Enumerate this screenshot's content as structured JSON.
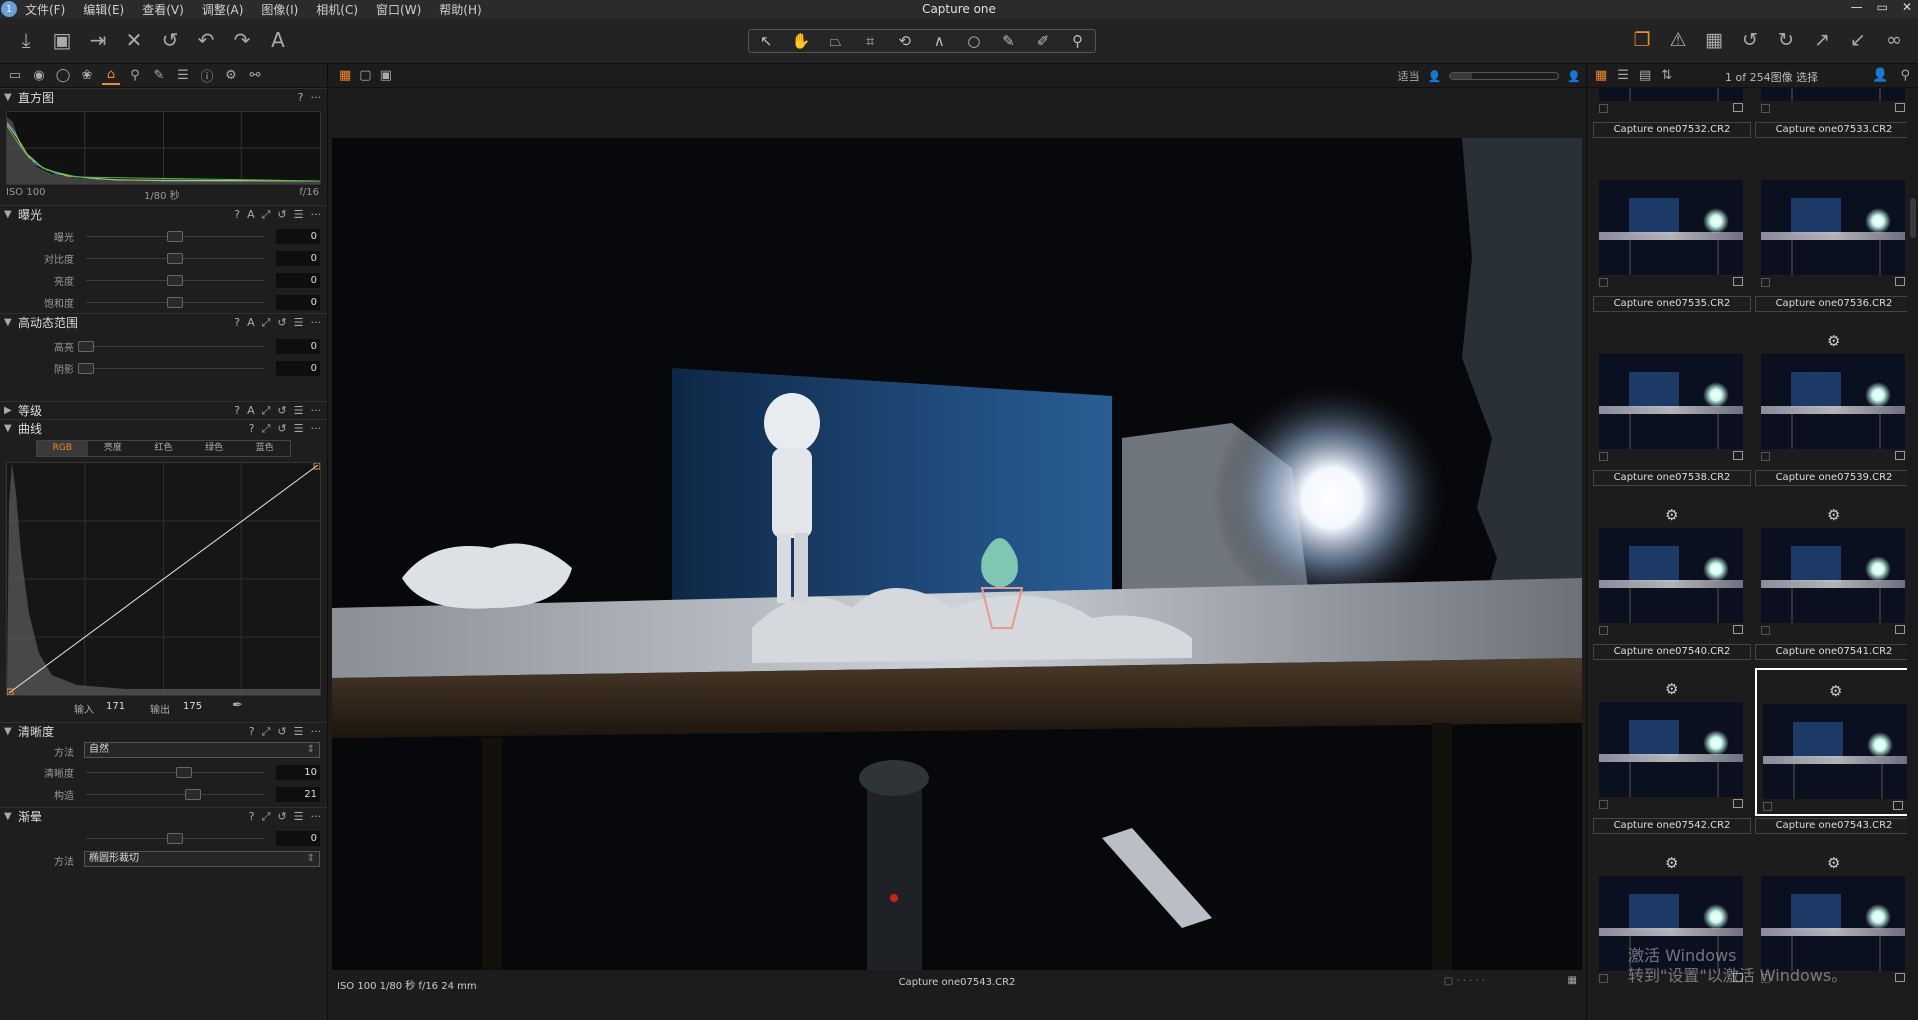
{
  "menubar": {
    "items": [
      "文件(F)",
      "编辑(E)",
      "查看(V)",
      "调整(A)",
      "图像(I)",
      "相机(C)",
      "窗口(W)",
      "帮助(H)"
    ],
    "title": "Capture one",
    "controls": [
      "—",
      "▭",
      "✕"
    ]
  },
  "toolbar": {
    "left": [
      {
        "icon": "import-icon",
        "glyph": "⤓"
      },
      {
        "icon": "camera-icon",
        "glyph": "▣"
      },
      {
        "icon": "folder-export-icon",
        "glyph": "⇥"
      },
      {
        "icon": "delete-icon",
        "glyph": "✕"
      },
      {
        "icon": "reset-icon",
        "glyph": "↺"
      },
      {
        "icon": "undo-icon",
        "glyph": "↶"
      },
      {
        "icon": "redo-icon",
        "glyph": "↷"
      },
      {
        "icon": "text-icon",
        "glyph": "A"
      }
    ],
    "tools": [
      {
        "icon": "select-pointer-icon",
        "glyph": "↖"
      },
      {
        "icon": "hand-pan-icon",
        "glyph": "✋",
        "active": true
      },
      {
        "icon": "keystone-icon",
        "glyph": "⏢"
      },
      {
        "icon": "crop-icon",
        "glyph": "⌗"
      },
      {
        "icon": "rotate-icon",
        "glyph": "⟲"
      },
      {
        "icon": "straighten-icon",
        "glyph": "∧"
      },
      {
        "icon": "spot-icon",
        "glyph": "○"
      },
      {
        "icon": "brush-icon",
        "glyph": "✎"
      },
      {
        "icon": "gradient-brush-icon",
        "glyph": "✐"
      },
      {
        "icon": "eyedropper-icon",
        "glyph": "⚲"
      }
    ],
    "right": [
      {
        "icon": "variants-icon",
        "glyph": "❐",
        "accent": true
      },
      {
        "icon": "warning-icon",
        "glyph": "⚠"
      },
      {
        "icon": "grid-overlay-icon",
        "glyph": "▦"
      },
      {
        "icon": "rotate-left-icon",
        "glyph": "↺"
      },
      {
        "icon": "rotate-right-icon",
        "glyph": "↻"
      },
      {
        "icon": "copy-adjustments-icon",
        "glyph": "↗"
      },
      {
        "icon": "apply-adjustments-icon",
        "glyph": "↙"
      },
      {
        "icon": "glasses-icon",
        "glyph": "∞"
      }
    ]
  },
  "left_tabs": [
    {
      "icon": "library-icon",
      "glyph": "▭"
    },
    {
      "icon": "capture-icon",
      "glyph": "◉"
    },
    {
      "icon": "lens-icon",
      "glyph": "◯"
    },
    {
      "icon": "color-icon",
      "glyph": "❀"
    },
    {
      "icon": "exposure-tab-icon",
      "glyph": "⌂",
      "active": true
    },
    {
      "icon": "details-icon",
      "glyph": "⚲"
    },
    {
      "icon": "local-adjust-icon",
      "glyph": "✎"
    },
    {
      "icon": "output-icon",
      "glyph": "☰"
    },
    {
      "icon": "metadata-icon",
      "glyph": "ⓘ"
    },
    {
      "icon": "settings-icon",
      "glyph": "⚙"
    },
    {
      "icon": "batch-icon",
      "glyph": "⚯"
    }
  ],
  "histogram": {
    "title": "直方图",
    "iso": "ISO 100",
    "shutter": "1/80 秒",
    "aperture": "f/16"
  },
  "exposure": {
    "title": "曝光",
    "rows": [
      {
        "label": "曝光",
        "value": "0",
        "pos": 0.5
      },
      {
        "label": "对比度",
        "value": "0",
        "pos": 0.5
      },
      {
        "label": "亮度",
        "value": "0",
        "pos": 0.5
      },
      {
        "label": "饱和度",
        "value": "0",
        "pos": 0.5
      }
    ]
  },
  "hdr": {
    "title": "高动态范围",
    "rows": [
      {
        "label": "高亮",
        "value": "0",
        "pos": 0
      },
      {
        "label": "阴影",
        "value": "0",
        "pos": 0
      }
    ]
  },
  "levels": {
    "title": "等级"
  },
  "curve": {
    "title": "曲线",
    "tabs": [
      "RGB",
      "亮度",
      "红色",
      "绿色",
      "蓝色"
    ],
    "active_tab": 0,
    "input_label": "输入",
    "input": "171",
    "output_label": "输出",
    "output": "175"
  },
  "clarity": {
    "title": "清晰度",
    "method_label": "方法",
    "method": "自然",
    "rows": [
      {
        "label": "清晰度",
        "value": "10",
        "pos": 0.55
      },
      {
        "label": "构造",
        "value": "21",
        "pos": 0.6
      }
    ]
  },
  "vignette": {
    "title": "渐晕",
    "rows": [
      {
        "label": "",
        "value": "0",
        "pos": 0.5
      }
    ],
    "method_label": "方法",
    "method": "椭圆形裁切"
  },
  "viewer": {
    "fit_label": "适当",
    "zoom_fraction": 0.2,
    "footer_left": "ISO 100  1/80 秒  f/16  24 mm",
    "footer_center": "Capture one07543.CR2"
  },
  "browser": {
    "count": "1 of 254图像 选择",
    "thumbs": [
      {
        "name": "Capture one07532.CR2",
        "gear": false
      },
      {
        "name": "Capture one07533.CR2",
        "gear": false
      },
      {
        "name": "Capture one07535.CR2",
        "gear": false
      },
      {
        "name": "Capture one07536.CR2",
        "gear": false
      },
      {
        "name": "Capture one07538.CR2",
        "gear": false
      },
      {
        "name": "Capture one07539.CR2",
        "gear": true
      },
      {
        "name": "Capture one07540.CR2",
        "gear": true
      },
      {
        "name": "Capture one07541.CR2",
        "gear": true
      },
      {
        "name": "Capture one07542.CR2",
        "gear": true
      },
      {
        "name": "Capture one07543.CR2",
        "gear": true,
        "selected": true
      },
      {
        "name": "",
        "gear": true
      },
      {
        "name": "",
        "gear": true
      }
    ]
  },
  "watermark": {
    "line1": "激活 Windows",
    "line2": "转到\"设置\"以激活 Windows。"
  },
  "colors": {
    "accent": "#f08a2a"
  }
}
